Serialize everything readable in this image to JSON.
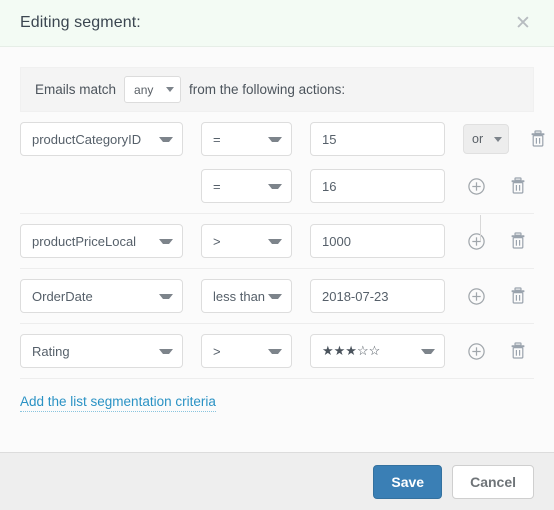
{
  "header": {
    "title": "Editing segment:",
    "close_icon": "close-icon",
    "close_glyph": "✕"
  },
  "match_bar": {
    "prefix_text": "Emails match",
    "match_value": "any",
    "suffix_text": "from the following actions:"
  },
  "rules": [
    {
      "group_id": 1,
      "rows": [
        {
          "field": "productCategoryID",
          "operator": "=",
          "value": "15",
          "value_kind": "text",
          "show_field": true,
          "conjunction": "or",
          "has_conjunction": true,
          "has_add": false,
          "has_delete": true
        },
        {
          "field": "",
          "operator": "=",
          "value": "16",
          "value_kind": "text",
          "show_field": false,
          "conjunction": "",
          "has_conjunction": false,
          "has_add": true,
          "has_delete": true
        }
      ]
    },
    {
      "group_id": 2,
      "rows": [
        {
          "field": "productPriceLocal",
          "operator": ">",
          "value": "1000",
          "value_kind": "text",
          "show_field": true,
          "conjunction": "",
          "has_conjunction": false,
          "has_add": true,
          "has_delete": true
        }
      ]
    },
    {
      "group_id": 3,
      "rows": [
        {
          "field": "OrderDate",
          "operator": "less than",
          "value": "2018-07-23",
          "value_kind": "text",
          "show_field": true,
          "conjunction": "",
          "has_conjunction": false,
          "has_add": true,
          "has_delete": true
        }
      ]
    },
    {
      "group_id": 4,
      "rows": [
        {
          "field": "Rating",
          "operator": ">",
          "value": "★★★☆☆",
          "value_kind": "select",
          "show_field": true,
          "conjunction": "",
          "has_conjunction": false,
          "has_add": true,
          "has_delete": true
        }
      ]
    }
  ],
  "add_criteria_link": "Add the list segmentation criteria",
  "footer": {
    "save_label": "Save",
    "cancel_label": "Cancel"
  },
  "icons": {
    "add": "plus-circle-icon",
    "delete": "trash-icon",
    "caret": "chevron-down-icon"
  },
  "colors": {
    "header_bg": "#f3fbf4",
    "primary_button": "#3a7fb5",
    "link": "#2a92c4",
    "footer_bg": "#eeeeee",
    "match_bar_bg": "#f4f4f4",
    "conjunction_bg": "#ededed"
  }
}
